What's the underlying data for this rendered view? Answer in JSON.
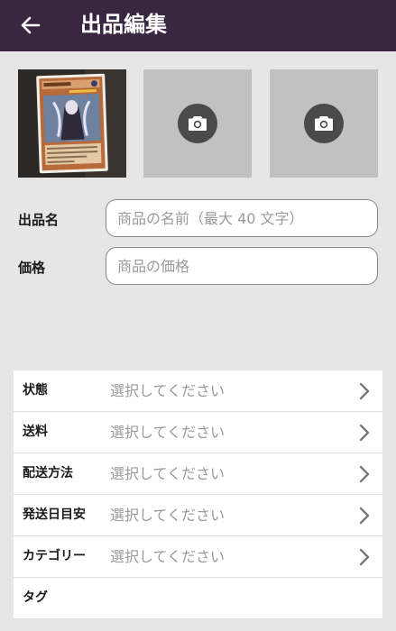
{
  "header": {
    "title": "出品編集",
    "back_icon": "arrow-left-icon",
    "background": "#392741"
  },
  "photos": {
    "slot1": "trading-card-photo",
    "slot2_icon": "camera-icon",
    "slot3_icon": "camera-icon"
  },
  "form": {
    "name_label": "出品名",
    "name_placeholder": "商品の名前（最大 40 文字）",
    "price_label": "価格",
    "price_placeholder": "商品の価格"
  },
  "settings": [
    {
      "label": "状態",
      "value": "選択してください"
    },
    {
      "label": "送料",
      "value": "選択してください"
    },
    {
      "label": "配送方法",
      "value": "選択してください"
    },
    {
      "label": "発送日目安",
      "value": "選択してください"
    },
    {
      "label": "カテゴリー",
      "value": "選択してください"
    },
    {
      "label": "タグ",
      "value": ""
    }
  ]
}
